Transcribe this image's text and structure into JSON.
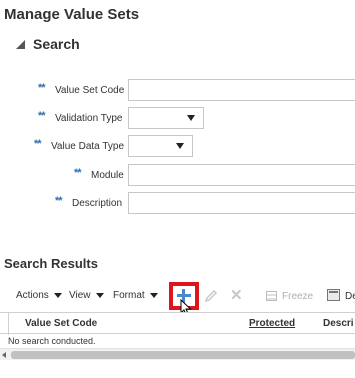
{
  "page": {
    "title": "Manage Value Sets"
  },
  "search": {
    "title": "Search",
    "required_marker": "**",
    "fields": {
      "value_set_code": {
        "label": "Value Set Code",
        "value": ""
      },
      "validation_type": {
        "label": "Validation Type",
        "value": ""
      },
      "value_data_type": {
        "label": "Value Data Type",
        "value": ""
      },
      "module": {
        "label": "Module",
        "value": ""
      },
      "description": {
        "label": "Description",
        "value": ""
      }
    }
  },
  "results": {
    "title": "Search Results",
    "toolbar": {
      "actions": "Actions",
      "view": "View",
      "format": "Format",
      "freeze": "Freeze",
      "detach": "De"
    },
    "columns": [
      "Value Set Code",
      "Protected",
      "Descri"
    ],
    "empty_message": "No search conducted."
  },
  "colors": {
    "required_marker": "#2f6fb0",
    "highlight_border": "#e0141c",
    "add_icon": "#4c88c8"
  },
  "icons": {
    "collapse": "triangle-collapse-icon",
    "add": "plus-icon",
    "edit": "pencil-icon",
    "delete": "x-icon",
    "freeze": "freeze-icon",
    "detach": "detach-icon",
    "cursor": "mouse-pointer-icon"
  }
}
